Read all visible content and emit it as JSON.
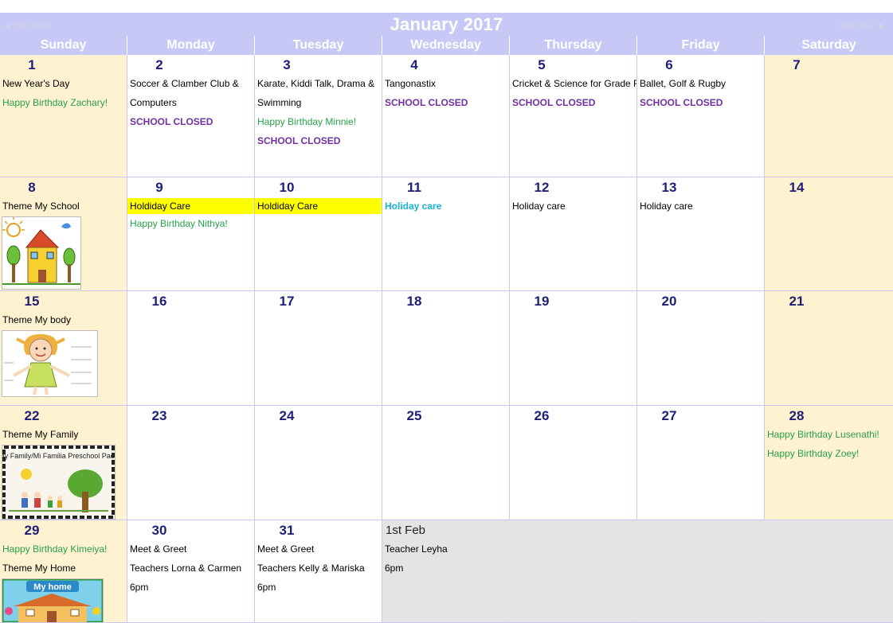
{
  "header": {
    "title": "January 2017",
    "prev_label": "◄ Dec 2016",
    "next_label": "Feb 2017 ►"
  },
  "weekdays": [
    "Sunday",
    "Monday",
    "Tuesday",
    "Wednesday",
    "Thursday",
    "Friday",
    "Saturday"
  ],
  "colors": {
    "header_bg": "#c8c8f6",
    "weekend_bg": "#fff2d0",
    "other_month_bg": "#e4e4e4",
    "day_number": "#1e1e78",
    "birthday_text": "#27a04b",
    "closed_text": "#7030a0",
    "highlight": "#ffff00",
    "holiday_blue": "#1ab0d8"
  },
  "weeks": [
    {
      "days": [
        {
          "num": "1",
          "events": [
            {
              "text": "New Year's Day"
            },
            {
              "text": "Happy Birthday Zachary!",
              "type": "bday"
            }
          ]
        },
        {
          "num": "2",
          "events": [
            {
              "text": "Soccer & Clamber Club & Computers",
              "type": "wrap"
            },
            {
              "text": "SCHOOL CLOSED",
              "type": "closed"
            }
          ]
        },
        {
          "num": "3",
          "events": [
            {
              "text": "Karate, Kiddi Talk, Drama & Swimming",
              "type": "wrap"
            },
            {
              "text": "Happy Birthday Minnie!",
              "type": "bday"
            },
            {
              "text": "SCHOOL CLOSED",
              "type": "closed multi"
            }
          ]
        },
        {
          "num": "4",
          "events": [
            {
              "text": "Tangonastix"
            },
            {
              "text": "SCHOOL CLOSED",
              "type": "closed"
            }
          ]
        },
        {
          "num": "5",
          "events": [
            {
              "text": "Cricket & Science for Grade R"
            },
            {
              "text": "SCHOOL CLOSED",
              "type": "closed"
            }
          ]
        },
        {
          "num": "6",
          "events": [
            {
              "text": "Ballet, Golf & Rugby"
            },
            {
              "text": "SCHOOL CLOSED",
              "type": "closed"
            }
          ]
        },
        {
          "num": "7",
          "events": []
        }
      ]
    },
    {
      "days": [
        {
          "num": "8",
          "events": [
            {
              "text": "Theme My School"
            }
          ],
          "image": "school-drawing"
        },
        {
          "num": "9",
          "events": [
            {
              "text": "Holdiday Care",
              "type": "hl"
            },
            {
              "text": "Happy Birthday Nithya!",
              "type": "bday"
            }
          ]
        },
        {
          "num": "10",
          "events": [
            {
              "text": "Holdiday Care",
              "type": "hl"
            }
          ]
        },
        {
          "num": "11",
          "events": [
            {
              "text": "Holiday care",
              "type": "blue"
            }
          ]
        },
        {
          "num": "12",
          "events": [
            {
              "text": "Holiday care"
            }
          ]
        },
        {
          "num": "13",
          "events": [
            {
              "text": "Holiday care"
            }
          ]
        },
        {
          "num": "14",
          "events": []
        }
      ]
    },
    {
      "days": [
        {
          "num": "15",
          "events": [
            {
              "text": "Theme My body"
            }
          ],
          "image": "body-drawing"
        },
        {
          "num": "16",
          "events": []
        },
        {
          "num": "17",
          "events": []
        },
        {
          "num": "18",
          "events": []
        },
        {
          "num": "19",
          "events": []
        },
        {
          "num": "20",
          "events": []
        },
        {
          "num": "21",
          "events": []
        }
      ]
    },
    {
      "days": [
        {
          "num": "22",
          "events": [
            {
              "text": "Theme My Family"
            }
          ],
          "image": "family-pack",
          "image_text": "My Family/Mi Familia Preschool Pack"
        },
        {
          "num": "23",
          "events": []
        },
        {
          "num": "24",
          "events": []
        },
        {
          "num": "25",
          "events": []
        },
        {
          "num": "26",
          "events": []
        },
        {
          "num": "27",
          "events": []
        },
        {
          "num": "28",
          "events": [
            {
              "text": "Happy Birthday Lusenathi!",
              "type": "bday"
            },
            {
              "text": "Happy Birthday Zoey!",
              "type": "bday"
            }
          ]
        }
      ]
    },
    {
      "days": [
        {
          "num": "29",
          "events": [
            {
              "text": "Happy Birthday Kimeiya!",
              "type": "bday"
            },
            {
              "text": "Theme My Home"
            }
          ],
          "image": "home-picture",
          "image_text": "My home"
        },
        {
          "num": "30",
          "events": [
            {
              "text": "Meet & Greet"
            },
            {
              "text": "Teachers Lorna & Carmen"
            },
            {
              "text": "6pm"
            }
          ]
        },
        {
          "num": "31",
          "events": [
            {
              "text": "Meet & Greet"
            },
            {
              "text": "Teachers Kelly & Mariska"
            },
            {
              "text": "6pm"
            }
          ]
        },
        {
          "num": "1st Feb",
          "other": true,
          "events": [
            {
              "text": "Teacher Leyha"
            },
            {
              "text": "6pm"
            }
          ]
        },
        {
          "num": "",
          "other": true,
          "events": []
        },
        {
          "num": "",
          "other": true,
          "events": []
        },
        {
          "num": "",
          "other": true,
          "events": []
        }
      ]
    }
  ]
}
